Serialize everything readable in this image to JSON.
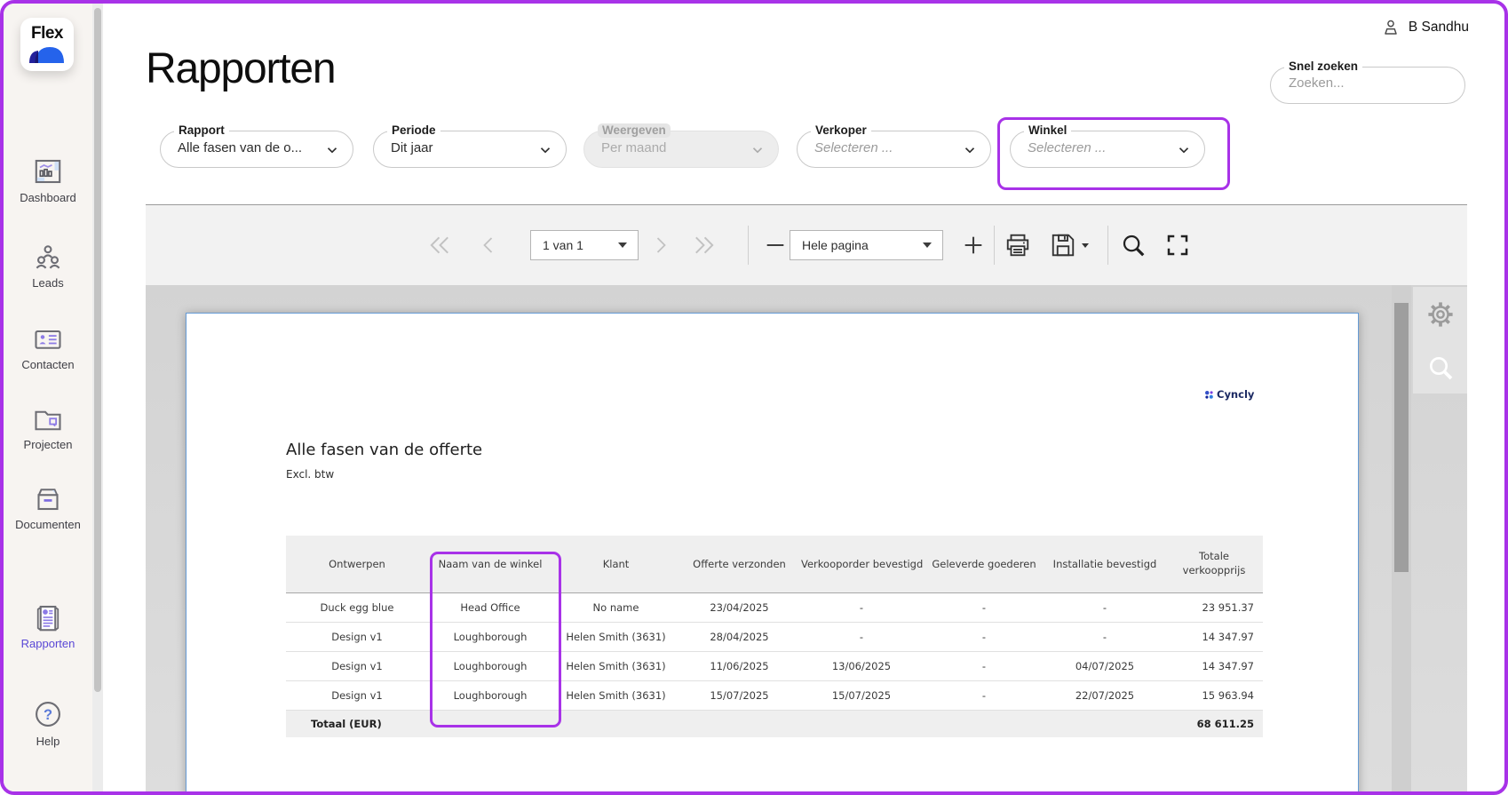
{
  "brand": {
    "logo_text": "Flex"
  },
  "user": {
    "name": "B Sandhu"
  },
  "page": {
    "title": "Rapporten"
  },
  "search": {
    "label": "Snel zoeken",
    "placeholder": "Zoeken..."
  },
  "sidebar": {
    "items": [
      {
        "label": "Dashboard",
        "icon": "dashboard-icon"
      },
      {
        "label": "Leads",
        "icon": "leads-icon"
      },
      {
        "label": "Contacten",
        "icon": "contacts-icon"
      },
      {
        "label": "Projecten",
        "icon": "projects-icon"
      },
      {
        "label": "Documenten",
        "icon": "documents-icon"
      },
      {
        "label": "Rapporten",
        "icon": "reports-icon",
        "active": true
      },
      {
        "label": "Help",
        "icon": "help-icon"
      }
    ]
  },
  "filters": [
    {
      "label": "Rapport",
      "value": "Alle fasen van de o..."
    },
    {
      "label": "Periode",
      "value": "Dit jaar"
    },
    {
      "label": "Weergeven",
      "value": "Per maand",
      "disabled": true
    },
    {
      "label": "Verkoper",
      "placeholder": "Selecteren ..."
    },
    {
      "label": "Winkel",
      "placeholder": "Selecteren ...",
      "highlighted": true
    }
  ],
  "toolbar": {
    "page_value": "1 van 1",
    "zoom_value": "Hele pagina",
    "icons": [
      "first-page",
      "previous-page",
      "next-page",
      "last-page",
      "zoom-out",
      "zoom-in",
      "print",
      "save",
      "search",
      "fullscreen"
    ],
    "pagination_disabled": true
  },
  "viewer_panel": {
    "icons": [
      "gear-icon",
      "search-icon"
    ]
  },
  "report": {
    "vendor": "Cyncly",
    "title": "Alle fasen van de offerte",
    "subtitle": "Excl. btw",
    "table": {
      "headers": [
        "Ontwerpen",
        "Naam van de winkel",
        "Klant",
        "Offerte verzonden",
        "Verkooporder bevestigd",
        "Geleverde goederen",
        "Installatie bevestigd",
        "Totale verkoopprijs"
      ],
      "rows": [
        [
          "Duck egg blue",
          "Head Office",
          "No name",
          "23/04/2025",
          "-",
          "-",
          "-",
          "23 951.37"
        ],
        [
          "Design v1",
          "Loughborough",
          "Helen Smith (3631)",
          "28/04/2025",
          "-",
          "-",
          "-",
          "14 347.97"
        ],
        [
          "Design v1",
          "Loughborough",
          "Helen Smith (3631)",
          "11/06/2025",
          "13/06/2025",
          "-",
          "04/07/2025",
          "14 347.97"
        ],
        [
          "Design v1",
          "Loughborough",
          "Helen Smith (3631)",
          "15/07/2025",
          "15/07/2025",
          "-",
          "22/07/2025",
          "15 963.94"
        ]
      ],
      "total_label": "Totaal (EUR)",
      "total_value": "68 611.25"
    }
  },
  "colors": {
    "annotation_purple": "#a832e8",
    "active_nav": "#5a48d6",
    "brand_blue": "#2563eb",
    "page_border_blue": "#659bd6"
  }
}
